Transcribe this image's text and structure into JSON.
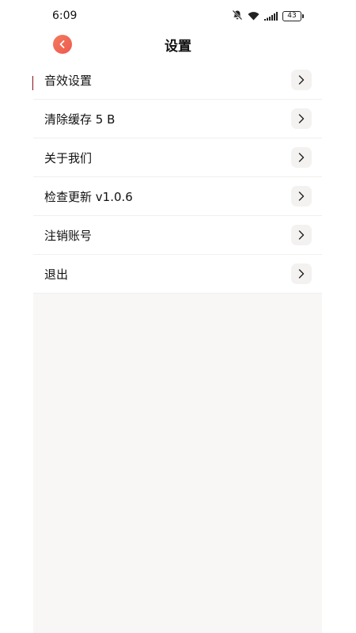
{
  "status_bar": {
    "time": "6:09",
    "icons": [
      "bell-muted-icon",
      "wifi-icon",
      "signal-icon",
      "battery-icon"
    ],
    "battery_level": "43"
  },
  "header": {
    "title": "设置",
    "back_icon": "chevron-left-icon",
    "accent_color": "#f0604f"
  },
  "settings": {
    "items": [
      {
        "label": "音效设置",
        "icon": "chevron-right-icon"
      },
      {
        "label": "清除缓存 5 B",
        "icon": "chevron-right-icon"
      },
      {
        "label": "关于我们",
        "icon": "chevron-right-icon"
      },
      {
        "label": "检查更新 v1.0.6",
        "icon": "chevron-right-icon"
      },
      {
        "label": "注销账号",
        "icon": "chevron-right-icon"
      },
      {
        "label": "退出",
        "icon": "chevron-right-icon"
      }
    ]
  }
}
